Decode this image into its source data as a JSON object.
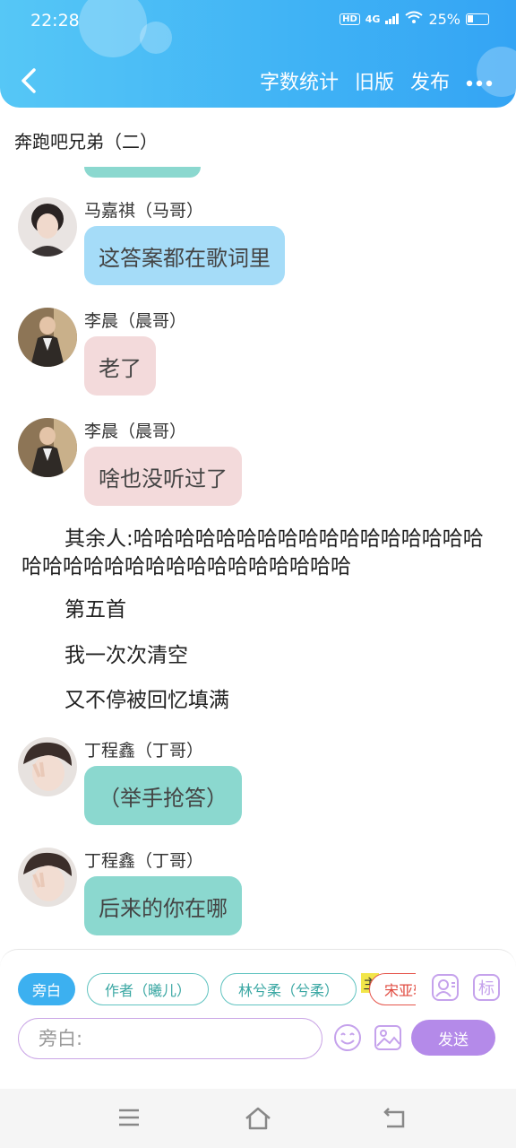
{
  "status": {
    "time": "22:28",
    "hd": "HD",
    "network": "4G",
    "battery": "25%"
  },
  "header": {
    "actions": [
      "字数统计",
      "旧版",
      "发布"
    ],
    "colors": {
      "gradient_start": "#56c7f6",
      "gradient_end": "#34a4f4"
    }
  },
  "page_title": "奔跑吧兄弟（二）",
  "messages": [
    {
      "name": "马嘉祺（马哥）",
      "text": "这答案都在歌词里",
      "color": "#a5dcf8",
      "avatar": "avatar-majiaqi"
    },
    {
      "name": "李晨（晨哥）",
      "text": "老了",
      "color": "#f3dadb",
      "avatar": "avatar-lichen"
    },
    {
      "name": "李晨（晨哥）",
      "text": "啥也没听过了",
      "color": "#f3dadb",
      "avatar": "avatar-lichen"
    },
    {
      "name": "丁程鑫（丁哥）",
      "text": "（举手抢答）",
      "color": "#8bd8cf",
      "avatar": "avatar-dingchengxin"
    },
    {
      "name": "丁程鑫（丁哥）",
      "text": "后来的你在哪",
      "color": "#8bd8cf",
      "avatar": "avatar-dingchengxin"
    }
  ],
  "narration": [
    "其余人:哈哈哈哈哈哈哈哈哈哈哈哈哈哈哈哈哈哈哈哈哈哈哈哈哈哈哈哈哈哈哈哈哈",
    "第五首",
    "我一次次清空",
    "又不停被回忆填满"
  ],
  "composer": {
    "chips": [
      "旁白",
      "作者（曦儿）",
      "林兮柔（兮柔）",
      "宋亚轩"
    ],
    "main_tag": "主",
    "placeholder": "旁白:",
    "send_label": "发送",
    "tag_icon_label": "标",
    "colors": {
      "active": "#3cb0f0",
      "send": "#b48ae9"
    }
  },
  "navbar": {
    "icons": [
      "menu-icon",
      "home-icon",
      "back-icon"
    ]
  }
}
